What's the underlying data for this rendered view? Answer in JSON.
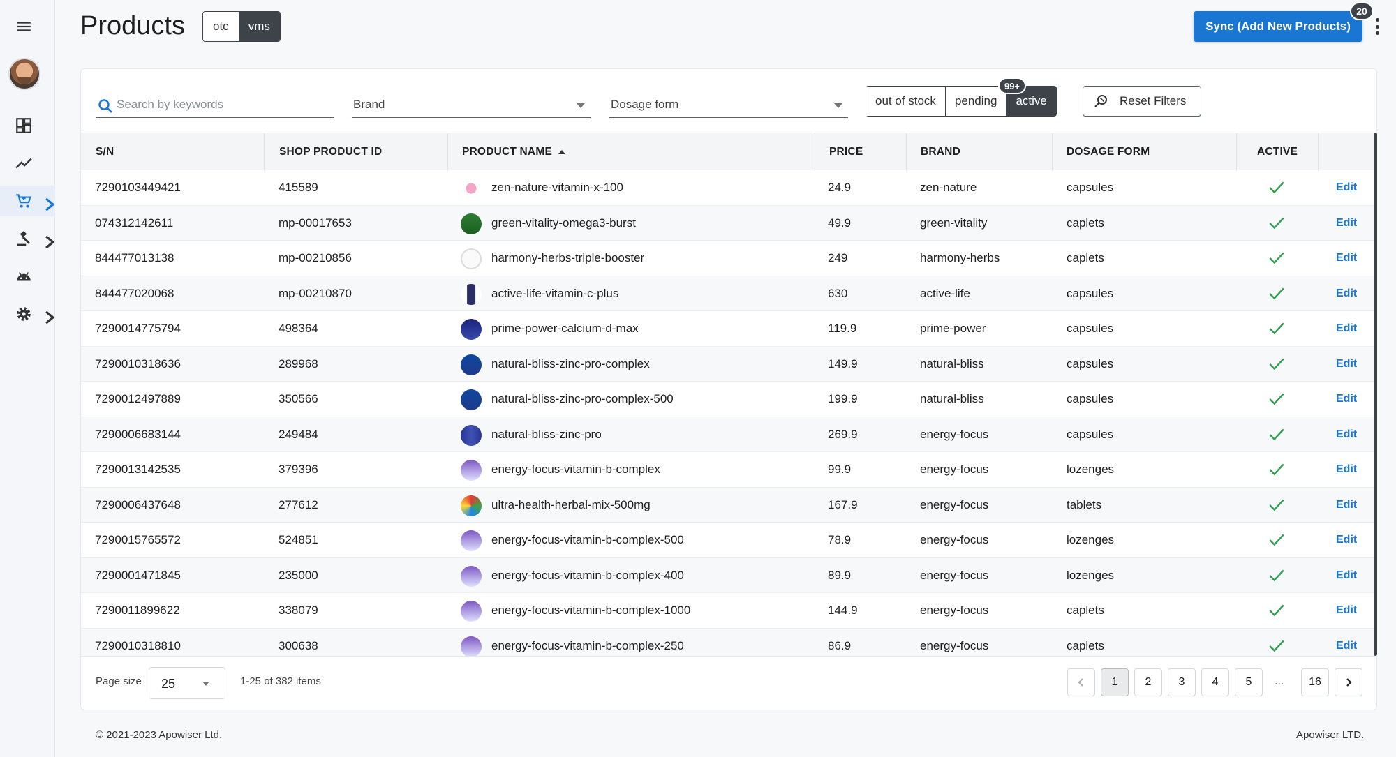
{
  "header": {
    "title": "Products",
    "segments": [
      "otc",
      "vms"
    ],
    "selected_segment": "vms",
    "sync_label": "Sync (Add New Products)",
    "sync_badge": "20"
  },
  "filters": {
    "search_placeholder": "Search by keywords",
    "brand_label": "Brand",
    "dosage_label": "Dosage form",
    "status_options": [
      "out of stock",
      "pending",
      "active"
    ],
    "selected_status": "active",
    "status_badge": "99+",
    "reset_label": "Reset Filters"
  },
  "table": {
    "columns": [
      "S/N",
      "SHOP PRODUCT ID",
      "PRODUCT NAME",
      "PRICE",
      "BRAND",
      "DOSAGE FORM",
      "ACTIVE"
    ],
    "sorted_column": "PRODUCT NAME",
    "sort_direction": "ascending",
    "edit_label": "Edit",
    "rows": [
      {
        "sn": "7290103449421",
        "shop_id": "415589",
        "name": "zen-nature-vitamin-x-100",
        "price": "24.9",
        "brand": "zen-nature",
        "dosage": "capsules",
        "active": true
      },
      {
        "sn": "074312142611",
        "shop_id": "mp-00017653",
        "name": "green-vitality-omega3-burst",
        "price": "49.9",
        "brand": "green-vitality",
        "dosage": "caplets",
        "active": true
      },
      {
        "sn": "844477013138",
        "shop_id": "mp-00210856",
        "name": "harmony-herbs-triple-booster",
        "price": "249",
        "brand": "harmony-herbs",
        "dosage": "caplets",
        "active": true
      },
      {
        "sn": "844477020068",
        "shop_id": "mp-00210870",
        "name": "active-life-vitamin-c-plus",
        "price": "630",
        "brand": "active-life",
        "dosage": "capsules",
        "active": true
      },
      {
        "sn": "7290014775794",
        "shop_id": "498364",
        "name": "prime-power-calcium-d-max",
        "price": "119.9",
        "brand": "prime-power",
        "dosage": "capsules",
        "active": true
      },
      {
        "sn": "7290010318636",
        "shop_id": "289968",
        "name": "natural-bliss-zinc-pro-complex",
        "price": "149.9",
        "brand": "natural-bliss",
        "dosage": "capsules",
        "active": true
      },
      {
        "sn": "7290012497889",
        "shop_id": "350566",
        "name": "natural-bliss-zinc-pro-complex-500",
        "price": "199.9",
        "brand": "natural-bliss",
        "dosage": "capsules",
        "active": true
      },
      {
        "sn": "7290006683144",
        "shop_id": "249484",
        "name": "natural-bliss-zinc-pro",
        "price": "269.9",
        "brand": "energy-focus",
        "dosage": "capsules",
        "active": true
      },
      {
        "sn": "7290013142535",
        "shop_id": "379396",
        "name": "energy-focus-vitamin-b-complex",
        "price": "99.9",
        "brand": "energy-focus",
        "dosage": "lozenges",
        "active": true
      },
      {
        "sn": "7290006437648",
        "shop_id": "277612",
        "name": "ultra-health-herbal-mix-500mg",
        "price": "167.9",
        "brand": "energy-focus",
        "dosage": "tablets",
        "active": true
      },
      {
        "sn": "7290015765572",
        "shop_id": "524851",
        "name": "energy-focus-vitamin-b-complex-500",
        "price": "78.9",
        "brand": "energy-focus",
        "dosage": "lozenges",
        "active": true
      },
      {
        "sn": "7290001471845",
        "shop_id": "235000",
        "name": "energy-focus-vitamin-b-complex-400",
        "price": "89.9",
        "brand": "energy-focus",
        "dosage": "lozenges",
        "active": true
      },
      {
        "sn": "7290011899622",
        "shop_id": "338079",
        "name": "energy-focus-vitamin-b-complex-1000",
        "price": "144.9",
        "brand": "energy-focus",
        "dosage": "caplets",
        "active": true
      },
      {
        "sn": "7290010318810",
        "shop_id": "300638",
        "name": "energy-focus-vitamin-b-complex-250",
        "price": "86.9",
        "brand": "energy-focus",
        "dosage": "caplets",
        "active": true
      }
    ]
  },
  "pagination": {
    "page_size_label": "Page size",
    "page_size": "25",
    "range_text": "1-25 of 382 items",
    "pages": [
      "1",
      "2",
      "3",
      "4",
      "5"
    ],
    "ellipsis": "...",
    "last_page": "16",
    "current_page": "1"
  },
  "footer": {
    "copyright": "© 2021-2023 Apowiser Ltd.",
    "company": "Apowiser LTD."
  },
  "colors": {
    "primary": "#1976d2",
    "dark": "#3e434a",
    "check": "#2e9e4f"
  },
  "icons": {
    "sidebar": [
      "menu-icon",
      "avatar",
      "dashboard-icon",
      "trend-icon",
      "cart-icon",
      "gavel-icon",
      "android-icon",
      "gear-icon"
    ]
  }
}
